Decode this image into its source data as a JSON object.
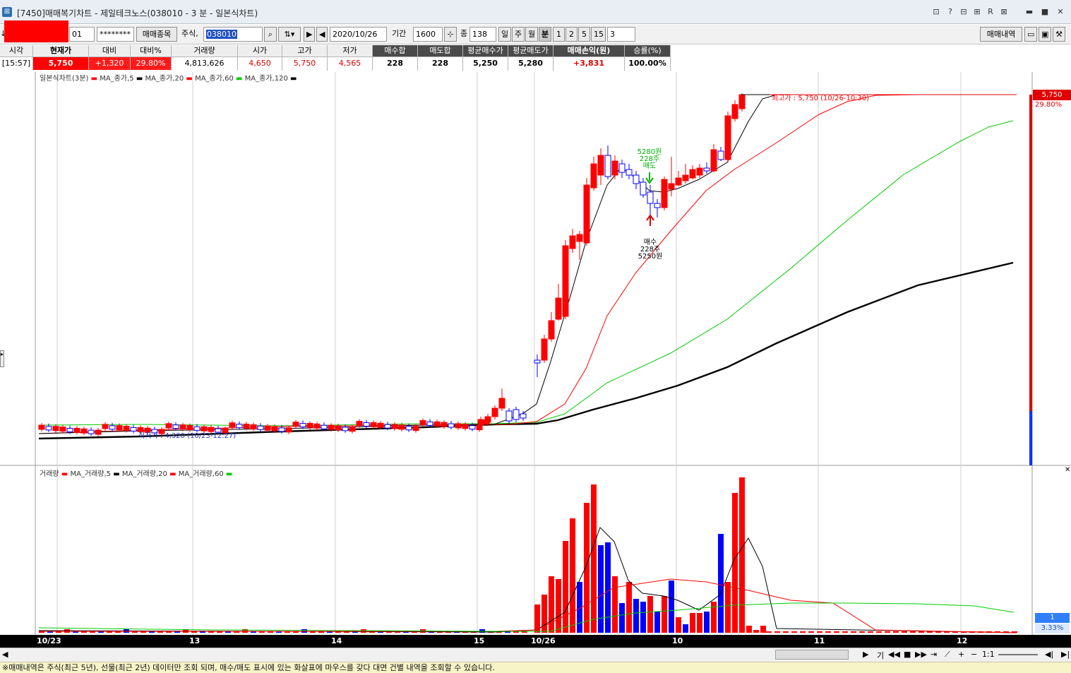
{
  "window": {
    "title": "[7450]매매복기차트 - 제일테크노스(038010 - 3 분 - 일본식차트)",
    "controls": [
      "⊡",
      "?",
      "⊟",
      "⊞",
      "R",
      "⊠",
      "▬",
      "■",
      "✕"
    ]
  },
  "toolbar": {
    "arrow_label": "↓",
    "account_suffix": "01",
    "password_mask": "********",
    "trade_items_button": "매매종목",
    "market_type": "주식,",
    "stock_code": "038010",
    "date": "2020/10/26",
    "period_label": "기간",
    "period_value": "1600",
    "count_label": "종",
    "count_value": "138",
    "unit_buttons": [
      "일",
      "주",
      "월",
      "분"
    ],
    "minute_options": [
      "1",
      "2",
      "5",
      "15"
    ],
    "minute_selected": "3",
    "trade_history_button": "매매내역"
  },
  "info": {
    "time_header": "시각",
    "time_value": "[15:57]",
    "columns": [
      {
        "header": "현재가",
        "value": "5,750"
      },
      {
        "header": "대비",
        "value": "+1,320"
      },
      {
        "header": "대비%",
        "value": "29.80%"
      },
      {
        "header": "거래량",
        "value": "4,813,626"
      },
      {
        "header": "시가",
        "value": "4,650"
      },
      {
        "header": "고가",
        "value": "5,750"
      },
      {
        "header": "저가",
        "value": "4,565"
      },
      {
        "header": "매수합",
        "value": "228"
      },
      {
        "header": "매도합",
        "value": "228"
      },
      {
        "header": "평균매수가",
        "value": "5,250"
      },
      {
        "header": "평균매도가",
        "value": "5,280"
      },
      {
        "header": "매매손익(원)",
        "value": "+3,831"
      },
      {
        "header": "승률(%)",
        "value": "100.00%"
      }
    ]
  },
  "price_chart": {
    "legend": [
      "일본식차트(3분)",
      "MA_종가,5",
      "MA_종가,20",
      "MA_종가,60",
      "MA_종가,120"
    ],
    "max_label": "최고가 : 5,750 (10/26-10:30)",
    "min_label": "최저가 : 4,320 (10/23-12:27)",
    "sell_annotation": [
      "5280원",
      "228주",
      "매도"
    ],
    "buy_annotation": [
      "매수",
      "228주",
      "5250원"
    ],
    "current_price": "5,750",
    "current_pct": "29.80%"
  },
  "volume_chart": {
    "legend": [
      "거래량",
      "MA_거래량,5",
      "MA_거래량,20",
      "MA_거래량,60"
    ],
    "right_value": "1",
    "right_pct": "3.33%"
  },
  "colors": {
    "up": "#ff0000",
    "down": "#0000ff",
    "ma5": "#000000",
    "ma20": "#ff0000",
    "ma60": "#00cc00",
    "ma120": "#000000",
    "sell_arrow": "#00b000",
    "buy_arrow": "#e00000"
  },
  "x_axis": {
    "labels": [
      "10/23",
      "13",
      "14",
      "15",
      "10/26",
      "10",
      "11",
      "12"
    ]
  },
  "scroll_controls": {
    "labels": [
      "기",
      "1:1"
    ]
  },
  "status_text": "※매매내역은 주식(최근 5년), 선물(최근 2년) 데이터만 조회 되며, 매수/매도 표시에 있는 화살표에 마우스를 갖다 대면 건별 내역을 조회할 수 있습니다."
}
